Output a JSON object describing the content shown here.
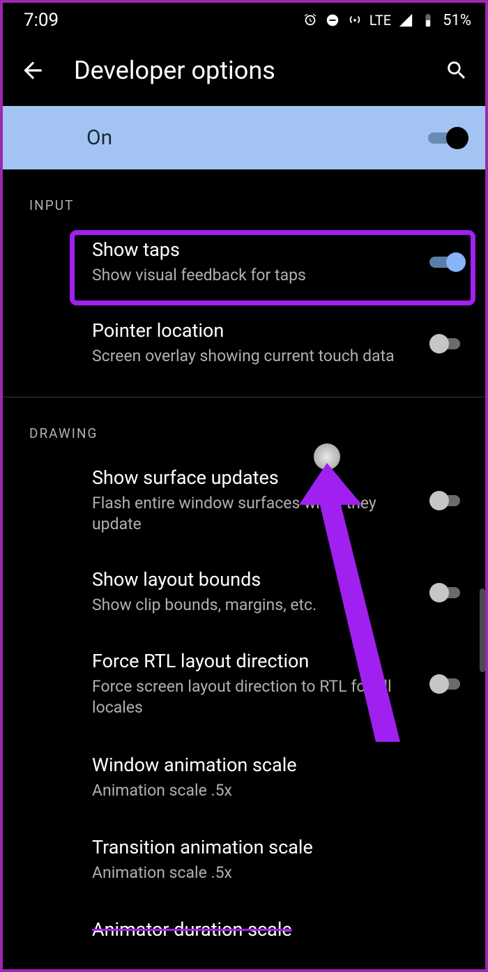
{
  "status": {
    "time": "7:09",
    "network": "LTE",
    "battery": "51%"
  },
  "header": {
    "title": "Developer options"
  },
  "master": {
    "label": "On",
    "enabled": true
  },
  "sections": [
    {
      "label": "INPUT",
      "items": [
        {
          "title": "Show taps",
          "sub": "Show visual feedback for taps",
          "toggle": true,
          "on": true,
          "highlighted": true
        },
        {
          "title": "Pointer location",
          "sub": "Screen overlay showing current touch data",
          "toggle": true,
          "on": false
        }
      ]
    },
    {
      "label": "DRAWING",
      "items": [
        {
          "title": "Show surface updates",
          "sub": "Flash entire window surfaces when they update",
          "toggle": true,
          "on": false
        },
        {
          "title": "Show layout bounds",
          "sub": "Show clip bounds, margins, etc.",
          "toggle": true,
          "on": false
        },
        {
          "title": "Force RTL layout direction",
          "sub": "Force screen layout direction to RTL for all locales",
          "toggle": true,
          "on": false
        },
        {
          "title": "Window animation scale",
          "sub": "Animation scale .5x",
          "toggle": false
        },
        {
          "title": "Transition animation scale",
          "sub": "Animation scale .5x",
          "toggle": false
        },
        {
          "title": "Animator duration scale",
          "sub": "",
          "toggle": false
        }
      ]
    }
  ]
}
